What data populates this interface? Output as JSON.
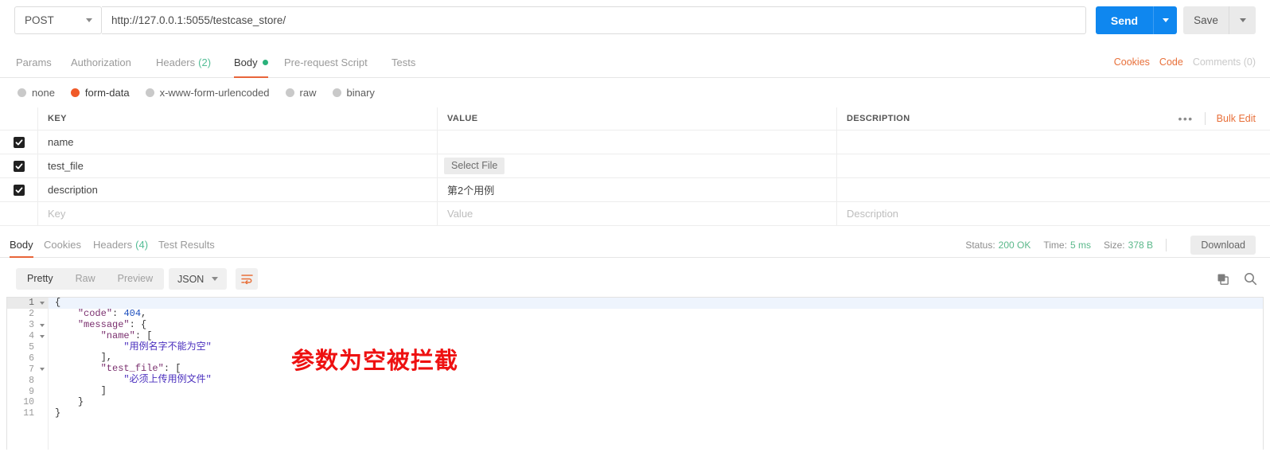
{
  "request": {
    "method": "POST",
    "url": "http://127.0.0.1:5055/testcase_store/",
    "send_label": "Send",
    "save_label": "Save",
    "tabs": [
      {
        "label": "Params",
        "count": "",
        "active": false
      },
      {
        "label": "Authorization",
        "count": "",
        "active": false
      },
      {
        "label": "Headers",
        "count": "(2)",
        "active": false
      },
      {
        "label": "Body",
        "count": "",
        "active": true,
        "dot": true
      },
      {
        "label": "Pre-request Script",
        "count": "",
        "active": false
      },
      {
        "label": "Tests",
        "count": "",
        "active": false
      }
    ],
    "links": [
      {
        "label": "Cookies",
        "muted": false
      },
      {
        "label": "Code",
        "muted": false
      },
      {
        "label": "Comments (0)",
        "muted": true
      }
    ],
    "body_types": [
      {
        "label": "none",
        "selected": false
      },
      {
        "label": "form-data",
        "selected": true
      },
      {
        "label": "x-www-form-urlencoded",
        "selected": false
      },
      {
        "label": "raw",
        "selected": false
      },
      {
        "label": "binary",
        "selected": false
      }
    ]
  },
  "kvtable": {
    "headers": {
      "key": "KEY",
      "value": "VALUE",
      "description": "DESCRIPTION"
    },
    "bulk_edit_label": "Bulk Edit",
    "dots_label": "•••",
    "rows": [
      {
        "checked": true,
        "key": "name",
        "value": "",
        "value_kind": "text",
        "description": ""
      },
      {
        "checked": true,
        "key": "test_file",
        "value": "Select File",
        "value_kind": "file",
        "description": ""
      },
      {
        "checked": true,
        "key": "description",
        "value": "第2个用例",
        "value_kind": "text",
        "description": ""
      }
    ],
    "placeholder_row": {
      "key": "Key",
      "value": "Value",
      "description": "Description"
    }
  },
  "response": {
    "tabs": [
      {
        "label": "Body",
        "count": "",
        "active": true
      },
      {
        "label": "Cookies",
        "count": "",
        "active": false
      },
      {
        "label": "Headers",
        "count": "(4)",
        "active": false
      },
      {
        "label": "Test Results",
        "count": "",
        "active": false
      }
    ],
    "status_label": "Status:",
    "status_value": "200 OK",
    "time_label": "Time:",
    "time_value": "5 ms",
    "size_label": "Size:",
    "size_value": "378 B",
    "download_label": "Download",
    "view_modes": [
      {
        "label": "Pretty",
        "active": true
      },
      {
        "label": "Raw",
        "active": false
      },
      {
        "label": "Preview",
        "active": false
      }
    ],
    "format": "JSON",
    "icons": {
      "wrap": "word-wrap-icon",
      "copy": "copy-icon",
      "search": "search-icon"
    },
    "code_lines": [
      {
        "num": "1",
        "fold": true,
        "highlight": true,
        "indent": 0,
        "tokens": [
          {
            "t": "p",
            "v": "{"
          }
        ]
      },
      {
        "num": "2",
        "fold": false,
        "highlight": false,
        "indent": 1,
        "tokens": [
          {
            "t": "k",
            "v": "\"code\""
          },
          {
            "t": "p",
            "v": ": "
          },
          {
            "t": "n",
            "v": "404"
          },
          {
            "t": "p",
            "v": ","
          }
        ]
      },
      {
        "num": "3",
        "fold": true,
        "highlight": false,
        "indent": 1,
        "tokens": [
          {
            "t": "k",
            "v": "\"message\""
          },
          {
            "t": "p",
            "v": ": {"
          }
        ]
      },
      {
        "num": "4",
        "fold": true,
        "highlight": false,
        "indent": 2,
        "tokens": [
          {
            "t": "k",
            "v": "\"name\""
          },
          {
            "t": "p",
            "v": ": ["
          }
        ]
      },
      {
        "num": "5",
        "fold": false,
        "highlight": false,
        "indent": 3,
        "tokens": [
          {
            "t": "s",
            "v": "\"用例名字不能为空\""
          }
        ]
      },
      {
        "num": "6",
        "fold": false,
        "highlight": false,
        "indent": 2,
        "tokens": [
          {
            "t": "p",
            "v": "],"
          }
        ]
      },
      {
        "num": "7",
        "fold": true,
        "highlight": false,
        "indent": 2,
        "tokens": [
          {
            "t": "k",
            "v": "\"test_file\""
          },
          {
            "t": "p",
            "v": ": ["
          }
        ]
      },
      {
        "num": "8",
        "fold": false,
        "highlight": false,
        "indent": 3,
        "tokens": [
          {
            "t": "s",
            "v": "\"必须上传用例文件\""
          }
        ]
      },
      {
        "num": "9",
        "fold": false,
        "highlight": false,
        "indent": 2,
        "tokens": [
          {
            "t": "p",
            "v": "]"
          }
        ]
      },
      {
        "num": "10",
        "fold": false,
        "highlight": false,
        "indent": 1,
        "tokens": [
          {
            "t": "p",
            "v": "}"
          }
        ]
      },
      {
        "num": "11",
        "fold": false,
        "highlight": false,
        "indent": 0,
        "tokens": [
          {
            "t": "p",
            "v": "}"
          }
        ]
      }
    ]
  },
  "annotation": {
    "text": "参数为空被拦截",
    "color": "#ee1111"
  },
  "colors": {
    "accent": "#e8653a",
    "send": "#0f87ef",
    "status_ok": "#5ab88a",
    "radio_selected": "#f05a28"
  }
}
